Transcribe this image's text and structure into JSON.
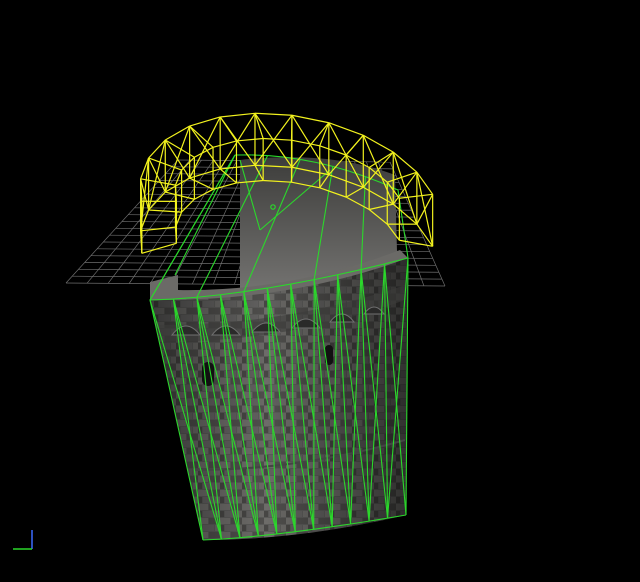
{
  "viewport": {
    "background_color": "#000000",
    "grid_color": "#8a8a8a",
    "upper_wireframe_color": "#f2f21e",
    "lower_wireframe_color": "#2bd82b",
    "axis_gizmo_color": "#3a6bff"
  }
}
